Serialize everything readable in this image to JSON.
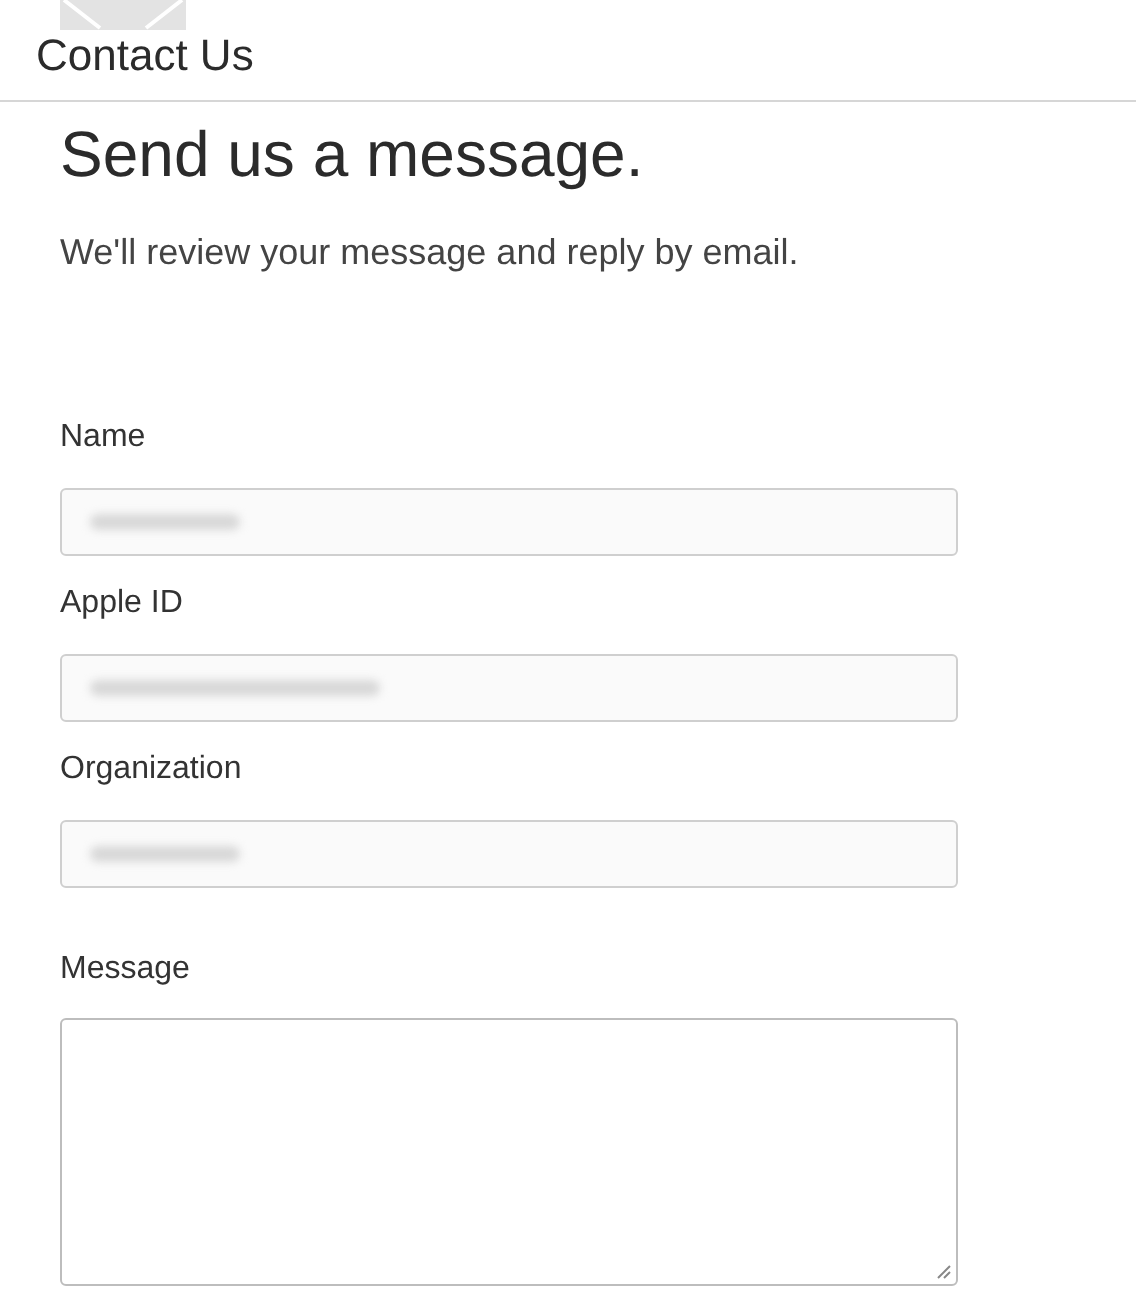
{
  "header": {
    "title": "Contact Us"
  },
  "heading": "Send us a message.",
  "subtitle": "We'll review your message and reply by email.",
  "fields": [
    {
      "kind": "input",
      "label": "Name",
      "redacted": true
    },
    {
      "kind": "input",
      "label": "Apple ID",
      "redacted": true
    },
    {
      "kind": "input",
      "label": "Organization",
      "redacted": true
    },
    {
      "kind": "textarea",
      "label": "Message"
    }
  ]
}
